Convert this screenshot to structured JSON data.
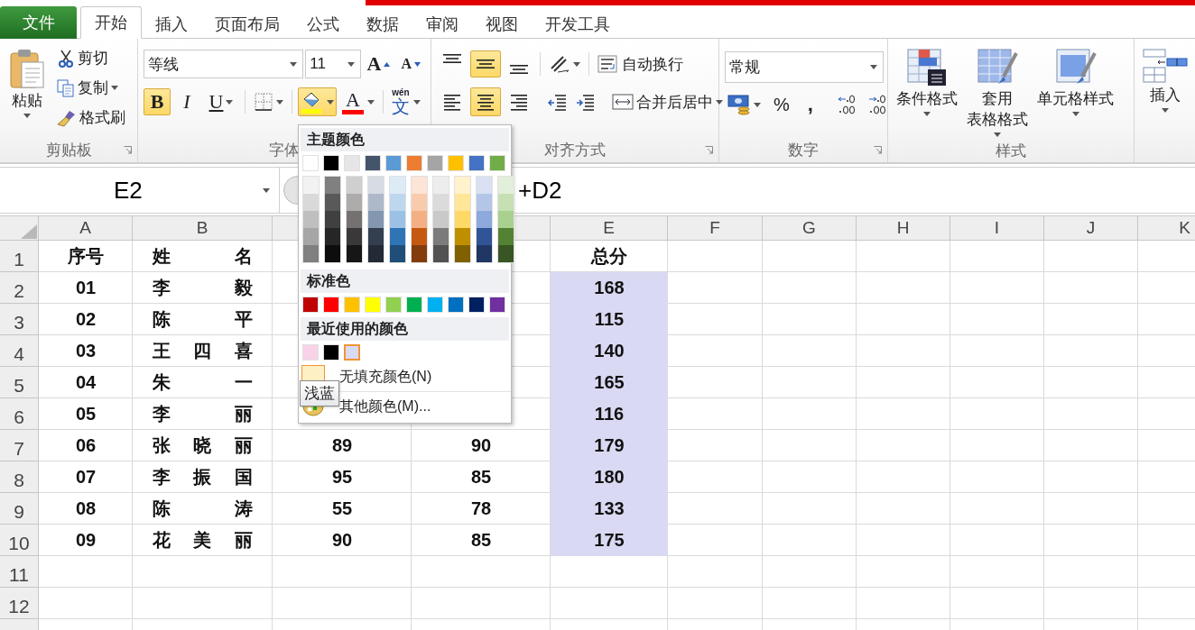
{
  "tabs": [
    {
      "label": "文件",
      "kind": "file",
      "selected": false
    },
    {
      "label": "开始",
      "kind": "tab",
      "selected": true
    },
    {
      "label": "插入",
      "kind": "tab",
      "selected": false
    },
    {
      "label": "页面布局",
      "kind": "tab",
      "selected": false
    },
    {
      "label": "公式",
      "kind": "tab",
      "selected": false
    },
    {
      "label": "数据",
      "kind": "tab",
      "selected": false
    },
    {
      "label": "审阅",
      "kind": "tab",
      "selected": false
    },
    {
      "label": "视图",
      "kind": "tab",
      "selected": false
    },
    {
      "label": "开发工具",
      "kind": "tab",
      "selected": false
    }
  ],
  "ribbon": {
    "clipboard": {
      "label": "剪贴板",
      "paste": "粘贴",
      "cut": "剪切",
      "copy": "复制",
      "format_painter": "格式刷"
    },
    "font": {
      "label": "字体",
      "name": "等线",
      "size": "11",
      "grow": "A",
      "shrink": "A",
      "bold": {
        "label": "B",
        "on": true
      },
      "italic": {
        "label": "I",
        "on": false
      },
      "underline": {
        "label": "U",
        "on": false
      },
      "fill_color": {
        "pressed": true
      },
      "font_color": {
        "label": "A"
      },
      "phonetic": {
        "pinyin": "wén",
        "char": "文"
      }
    },
    "alignment": {
      "label": "对齐方式",
      "vertical": [
        {
          "kind": "top",
          "selected": false
        },
        {
          "kind": "middle",
          "selected": true
        },
        {
          "kind": "bottom",
          "selected": false
        }
      ],
      "horizontal": [
        {
          "kind": "left",
          "selected": false
        },
        {
          "kind": "center",
          "selected": true
        },
        {
          "kind": "right",
          "selected": false
        }
      ],
      "wrap_text": "自动换行",
      "merge_center": "合并后居中"
    },
    "number": {
      "label": "数字",
      "format": "常规",
      "percent": "%",
      "comma": ","
    },
    "styles": {
      "label": "样式",
      "conditional": "条件格式",
      "table_format": [
        "套用",
        "表格格式"
      ],
      "cell_styles": "单元格样式"
    },
    "cells": {
      "insert": "插入"
    }
  },
  "formula_bar": {
    "name_box": "E2",
    "formula": "+D2"
  },
  "sheet": {
    "columns": [
      {
        "header": "A"
      },
      {
        "header": "B"
      },
      {},
      {},
      {
        "header": "E"
      },
      {
        "header": "F"
      },
      {
        "header": "G"
      },
      {
        "header": "H"
      },
      {
        "header": "I"
      },
      {
        "header": "J"
      },
      {
        "header": "K"
      }
    ],
    "rows": [
      {
        "number": "1",
        "a": "序号",
        "b": "姓名",
        "e": "总分",
        "total_filled": false
      },
      {
        "number": "2",
        "a": "01",
        "b": "李 毅",
        "e": "168",
        "total_filled": true
      },
      {
        "number": "3",
        "a": "02",
        "b": "陈 平",
        "e": "115",
        "total_filled": true
      },
      {
        "number": "4",
        "a": "03",
        "b": "王 四 喜",
        "e": "140",
        "total_filled": true
      },
      {
        "number": "5",
        "a": "04",
        "b": "朱 一",
        "e": "165",
        "total_filled": true
      },
      {
        "number": "6",
        "a": "05",
        "b": "李 丽",
        "e": "116",
        "total_filled": true
      },
      {
        "number": "7",
        "a": "06",
        "b": "张 晓 丽",
        "c": "89",
        "d": "90",
        "e": "179",
        "total_filled": true
      },
      {
        "number": "8",
        "a": "07",
        "b": "李 振 国",
        "c": "95",
        "d": "85",
        "e": "180",
        "total_filled": true
      },
      {
        "number": "9",
        "a": "08",
        "b": "陈 涛",
        "c": "55",
        "d": "78",
        "e": "133",
        "total_filled": true
      },
      {
        "number": "10",
        "a": "09",
        "b": "花 美 丽",
        "c": "90",
        "d": "85",
        "e": "175",
        "total_filled": true
      },
      {
        "number": "11",
        "total_filled": false
      },
      {
        "number": "12",
        "total_filled": false
      }
    ]
  },
  "color_menu": {
    "theme_title": "主题颜色",
    "theme_colors": [
      {
        "color": "#ffffff",
        "shades": [
          {
            "color": "#f2f2f2"
          },
          {
            "color": "#d9d9d9"
          },
          {
            "color": "#bfbfbf"
          },
          {
            "color": "#a6a6a6"
          },
          {
            "color": "#808080"
          }
        ]
      },
      {
        "color": "#000000",
        "shades": [
          {
            "color": "#808080"
          },
          {
            "color": "#595959"
          },
          {
            "color": "#404040"
          },
          {
            "color": "#262626"
          },
          {
            "color": "#0d0d0d"
          }
        ]
      },
      {
        "color": "#e7e6e6",
        "shades": [
          {
            "color": "#d0cece"
          },
          {
            "color": "#aeabab"
          },
          {
            "color": "#757171"
          },
          {
            "color": "#3a3838"
          },
          {
            "color": "#171616"
          }
        ]
      },
      {
        "color": "#44546a",
        "shades": [
          {
            "color": "#d6dce4"
          },
          {
            "color": "#adb9ca"
          },
          {
            "color": "#8497b0"
          },
          {
            "color": "#333f4f"
          },
          {
            "color": "#222b35"
          }
        ]
      },
      {
        "color": "#5b9bd5",
        "shades": [
          {
            "color": "#ddebf7"
          },
          {
            "color": "#bdd7ee"
          },
          {
            "color": "#9bc2e6"
          },
          {
            "color": "#2f75b5"
          },
          {
            "color": "#1f4e78"
          }
        ]
      },
      {
        "color": "#ed7d31",
        "shades": [
          {
            "color": "#fce4d6"
          },
          {
            "color": "#f8cbad"
          },
          {
            "color": "#f4b084"
          },
          {
            "color": "#c65911"
          },
          {
            "color": "#833c0c"
          }
        ]
      },
      {
        "color": "#a5a5a5",
        "shades": [
          {
            "color": "#ededed"
          },
          {
            "color": "#dbdbdb"
          },
          {
            "color": "#c9c9c9"
          },
          {
            "color": "#7b7b7b"
          },
          {
            "color": "#525252"
          }
        ]
      },
      {
        "color": "#ffc000",
        "shades": [
          {
            "color": "#fff2cc"
          },
          {
            "color": "#ffe699"
          },
          {
            "color": "#ffd966"
          },
          {
            "color": "#bf8f00"
          },
          {
            "color": "#806000"
          }
        ]
      },
      {
        "color": "#4472c4",
        "shades": [
          {
            "color": "#d9e1f2"
          },
          {
            "color": "#b4c6e7"
          },
          {
            "color": "#8ea9db"
          },
          {
            "color": "#305496"
          },
          {
            "color": "#203764"
          }
        ]
      },
      {
        "color": "#70ad47",
        "shades": [
          {
            "color": "#e2efda"
          },
          {
            "color": "#c6e0b4"
          },
          {
            "color": "#a9d08e"
          },
          {
            "color": "#548235"
          },
          {
            "color": "#375623"
          }
        ]
      }
    ],
    "standard_title": "标准色",
    "standard_colors": [
      {
        "color": "#c00000"
      },
      {
        "color": "#ff0000"
      },
      {
        "color": "#ffc000"
      },
      {
        "color": "#ffff00"
      },
      {
        "color": "#92d050"
      },
      {
        "color": "#00b050"
      },
      {
        "color": "#00b0f0"
      },
      {
        "color": "#0070c0"
      },
      {
        "color": "#002060"
      },
      {
        "color": "#7030a0"
      }
    ],
    "recent_title": "最近使用的颜色",
    "recent_colors": [
      {
        "color": "#f8d3e8",
        "selected": false
      },
      {
        "color": "#000000",
        "selected": false
      },
      {
        "color": "#dadaf5",
        "selected": true
      }
    ],
    "no_fill": {
      "label": "无填充颜色(N)",
      "highlighted": true
    },
    "more_colors": "其他颜色(M)...",
    "tooltip": "浅蓝"
  }
}
